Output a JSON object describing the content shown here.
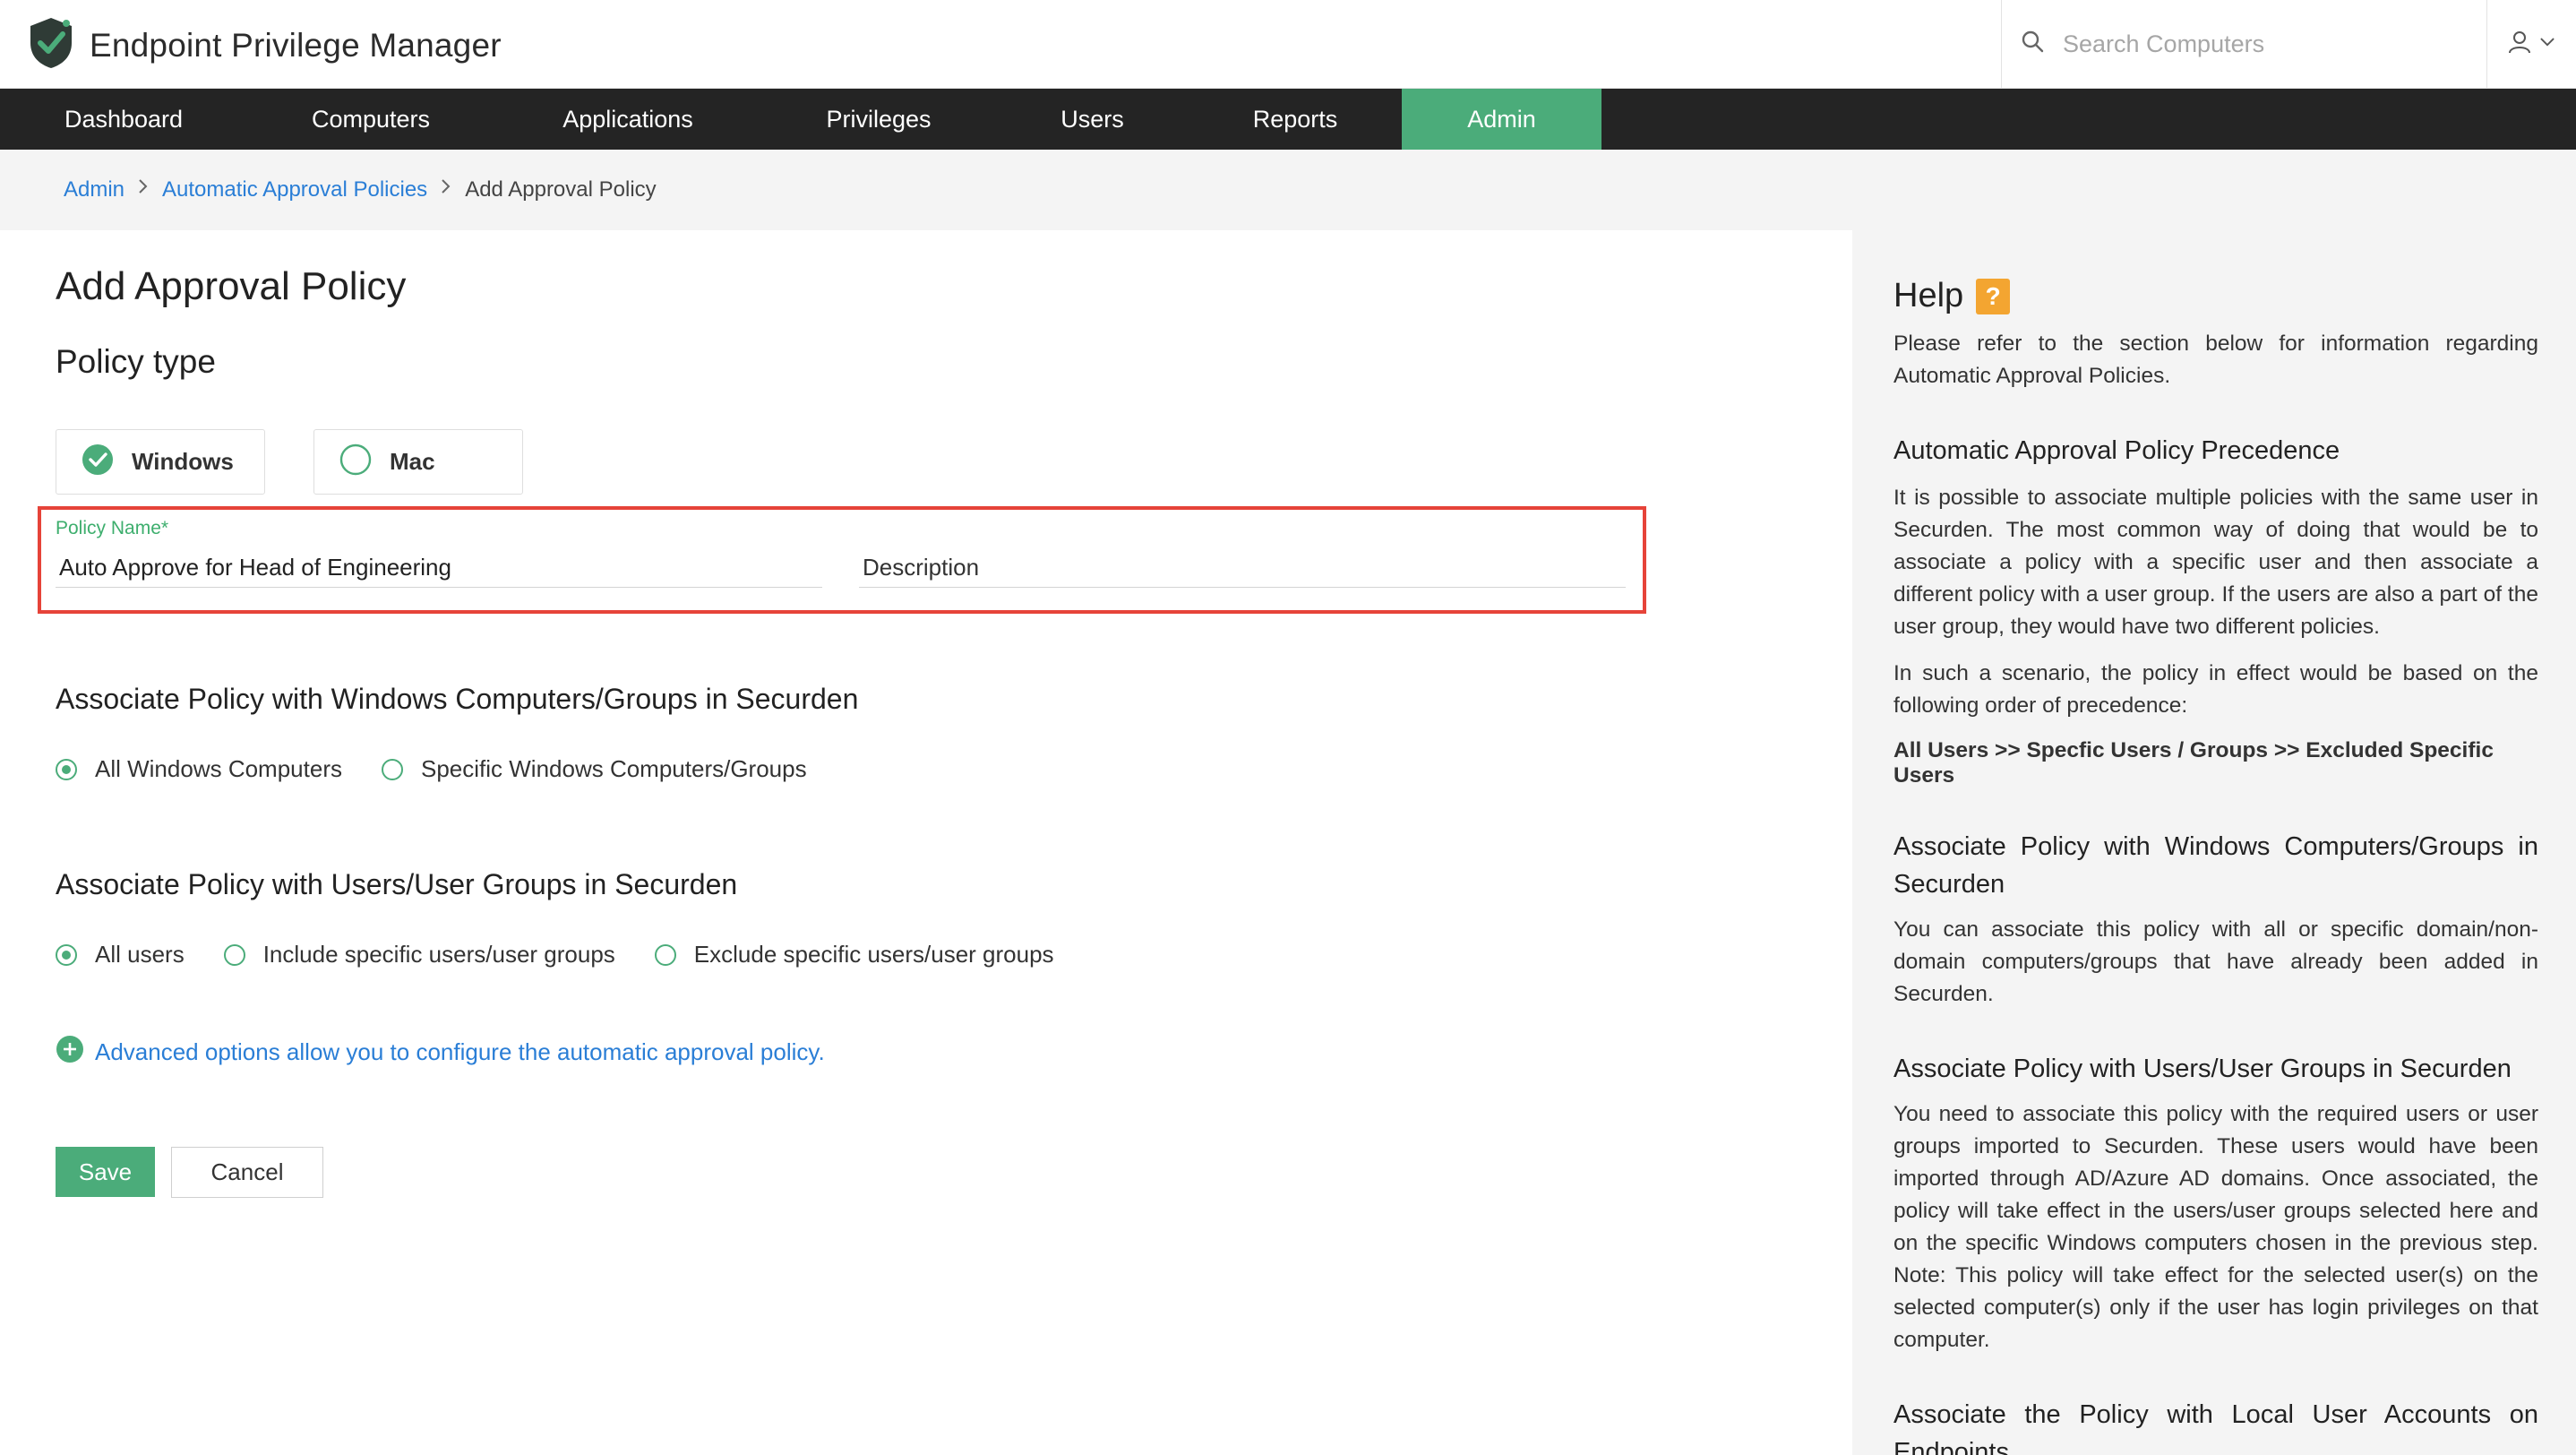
{
  "app": {
    "title": "Endpoint Privilege Manager"
  },
  "header": {
    "search_placeholder": "Search Computers"
  },
  "nav": {
    "items": [
      {
        "label": "Dashboard",
        "active": false
      },
      {
        "label": "Computers",
        "active": false
      },
      {
        "label": "Applications",
        "active": false
      },
      {
        "label": "Privileges",
        "active": false
      },
      {
        "label": "Users",
        "active": false
      },
      {
        "label": "Reports",
        "active": false
      },
      {
        "label": "Admin",
        "active": true
      }
    ]
  },
  "breadcrumb": {
    "items": [
      "Admin",
      "Automatic Approval Policies"
    ],
    "current": "Add Approval Policy"
  },
  "form": {
    "page_title": "Add Approval Policy",
    "policy_type_title": "Policy type",
    "os_options": [
      {
        "label": "Windows",
        "selected": true
      },
      {
        "label": "Mac",
        "selected": false
      }
    ],
    "policy_name_label": "Policy Name*",
    "policy_name_value": "Auto Approve for Head of Engineering",
    "description_placeholder": "Description",
    "computers_section_title": "Associate Policy with Windows Computers/Groups in Securden",
    "computer_options": [
      {
        "label": "All Windows Computers",
        "selected": true
      },
      {
        "label": "Specific Windows Computers/Groups",
        "selected": false
      }
    ],
    "users_section_title": "Associate Policy with Users/User Groups in Securden",
    "user_options": [
      {
        "label": "All users",
        "selected": true
      },
      {
        "label": "Include specific users/user groups",
        "selected": false
      },
      {
        "label": "Exclude specific users/user groups",
        "selected": false
      }
    ],
    "advanced_link": "Advanced options allow you to configure the automatic approval policy.",
    "save_label": "Save",
    "cancel_label": "Cancel"
  },
  "help": {
    "title": "Help",
    "badge": "?",
    "intro": "Please refer to the section below for information regarding Automatic Approval Policies.",
    "sections": [
      {
        "heading": "Automatic Approval Policy Precedence",
        "paragraphs": [
          "It is possible to associate multiple policies with the same user in Securden. The most common way of doing that would be to associate a policy with a specific user and then associate a different policy with a user group. If the users are also a part of the user group, they would have two different policies.",
          "In such a scenario, the policy in effect would be based on the following order of precedence:"
        ],
        "strong": "All Users >> Specfic Users / Groups >> Excluded Specific Users"
      },
      {
        "heading": "Associate Policy with Windows Computers/Groups in Securden",
        "paragraphs": [
          "You can associate this policy with all or specific domain/non-domain computers/groups that have already been added in Securden."
        ]
      },
      {
        "heading": "Associate Policy with Users/User Groups in Securden",
        "paragraphs": [
          "You need to associate this policy with the required users or user groups imported to Securden. These users would have been imported through AD/Azure AD domains. Once associated, the policy will take effect in the users/user groups selected here and on the specific Windows computers chosen in the previous step. Note: This policy will take effect for the selected user(s) on the selected computer(s) only if the user has login privileges on that computer."
        ]
      },
      {
        "heading": "Associate the Policy with Local User Accounts on Endpoints",
        "paragraphs": []
      }
    ]
  },
  "colors": {
    "accent_green": "#4bac7a",
    "link_blue": "#2a7ed6",
    "nav_bg": "#242424",
    "highlight_red": "#e64339",
    "help_badge": "#f3a531"
  }
}
